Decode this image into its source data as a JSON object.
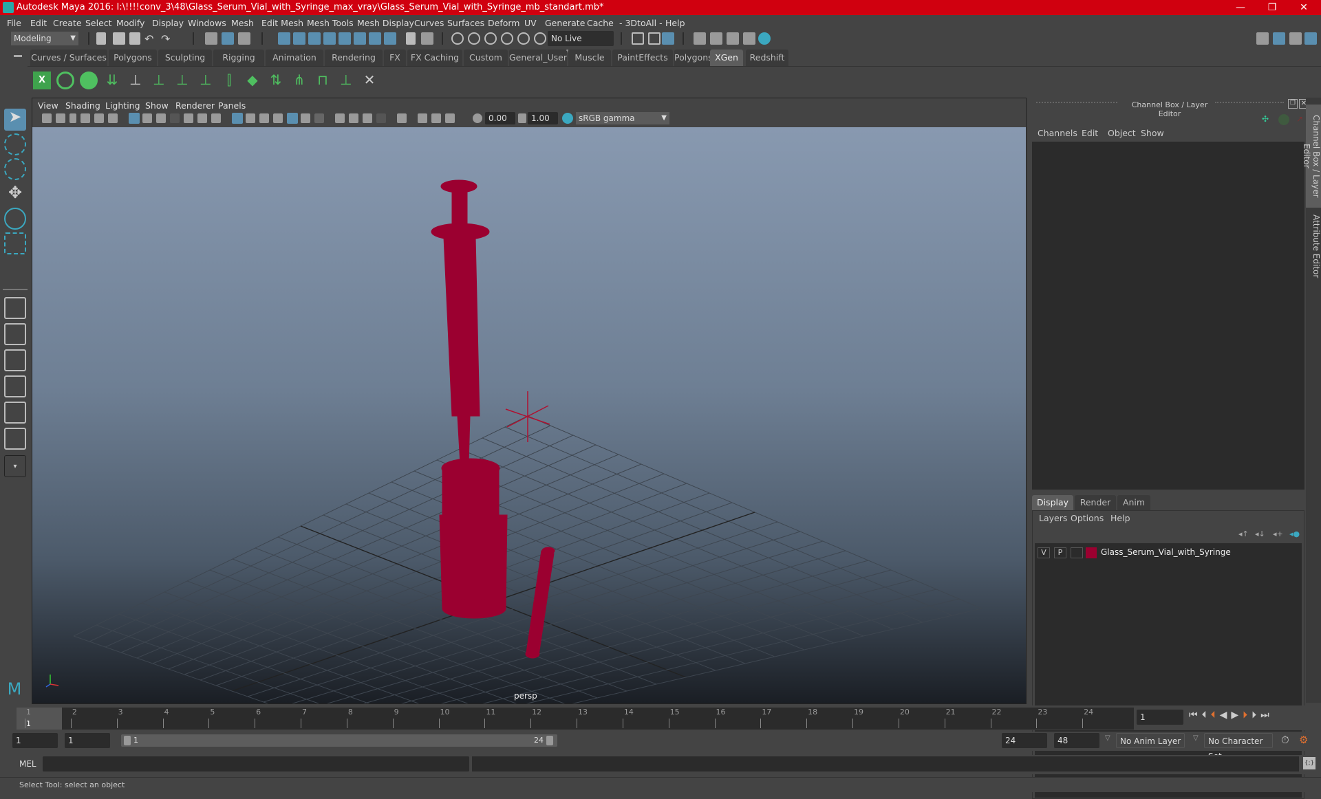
{
  "window": {
    "title": "Autodesk Maya 2016: I:\\!!!!conv_3\\48\\Glass_Serum_Vial_with_Syringe_max_vray\\Glass_Serum_Vial_with_Syringe_mb_standart.mb*",
    "minimize": "—",
    "maximize": "❐",
    "close": "✕"
  },
  "menubar": [
    "File",
    "Edit",
    "Create",
    "Select",
    "Modify",
    "Display",
    "Windows",
    "Mesh",
    "Edit Mesh",
    "Mesh Tools",
    "Mesh Display",
    "Curves",
    "Surfaces",
    "Deform",
    "UV",
    "Generate",
    "Cache",
    "- 3DtoAll -",
    "Help"
  ],
  "statusline": {
    "mode": "Modeling",
    "live_surface": "No Live Surface"
  },
  "shelf": {
    "tabs": [
      "Curves / Surfaces",
      "Polygons",
      "Sculpting",
      "Rigging",
      "Animation",
      "Rendering",
      "FX",
      "FX Caching",
      "Custom",
      "General_User",
      "Muscle",
      "PaintEffects",
      "Polygons_User",
      "XGen",
      "Redshift"
    ],
    "active_tab": "XGen",
    "icons": [
      "xgen-editor-icon",
      "xgen-visibility-icon",
      "xgen-hide-icon",
      "xgen-add-guide-icon",
      "xgen-place-icon",
      "xgen-guide-a-icon",
      "xgen-guide-b-icon",
      "xgen-guide-c-icon",
      "xgen-guide-d-icon",
      "xgen-grass-icon",
      "xgen-plane-icon",
      "xgen-sculpt-icon",
      "xgen-comb-icon",
      "xgen-cut-icon",
      "xgen-delete-icon"
    ]
  },
  "toolbox": [
    "select-tool-icon",
    "lasso-tool-icon",
    "paint-select-tool-icon",
    "move-tool-icon",
    "rotate-tool-icon",
    "scale-tool-icon"
  ],
  "viewport": {
    "menu": [
      "View",
      "Shading",
      "Lighting",
      "Show",
      "Renderer",
      "Panels"
    ],
    "exposure": "0.00",
    "gamma": "1.00",
    "colorspace": "sRGB gamma",
    "camera_label": "persp",
    "wire_color": "#9b0030"
  },
  "channelbox": {
    "header": "Channel Box / Layer Editor",
    "menu": [
      "Channels",
      "Edit",
      "Object",
      "Show"
    ]
  },
  "layer_editor": {
    "tabs": [
      "Display",
      "Render",
      "Anim"
    ],
    "active_tab": "Display",
    "menu": [
      "Layers",
      "Options",
      "Help"
    ],
    "layers": [
      {
        "v": "V",
        "p": "P",
        "color": "#9b0030",
        "name": "Glass_Serum_Vial_with_Syringe"
      }
    ]
  },
  "sidetabs": [
    "Channel Box / Layer Editor",
    "Attribute Editor"
  ],
  "timeline": {
    "ticks": [
      "1",
      "2",
      "3",
      "4",
      "5",
      "6",
      "7",
      "8",
      "9",
      "10",
      "11",
      "12",
      "13",
      "14",
      "15",
      "16",
      "17",
      "18",
      "19",
      "20",
      "21",
      "22",
      "23",
      "24"
    ],
    "current_frame_marker": "1",
    "current_frame": "1"
  },
  "range": {
    "start": "1",
    "playback_start": "1",
    "slider_start": "1",
    "slider_end": "24",
    "playback_end": "24",
    "end": "48",
    "anim_layer": "No Anim Layer",
    "character_set": "No Character Set"
  },
  "command": {
    "label": "MEL"
  },
  "help_line": "Select Tool: select an object"
}
